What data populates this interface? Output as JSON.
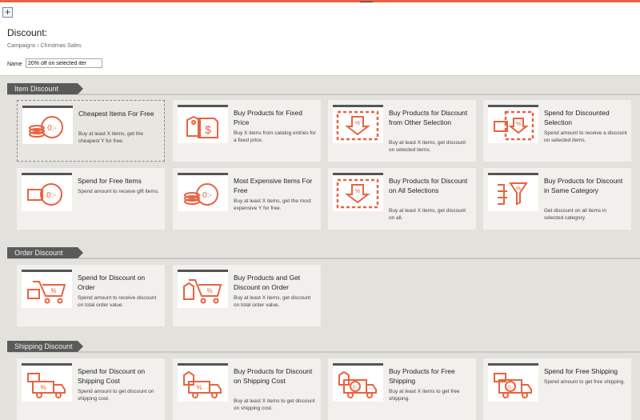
{
  "header": {
    "title": "Discount:",
    "breadcrumb": "Campaigns › Christmas Sales",
    "name_label": "Name",
    "name_value": "20% off on selected iter",
    "add_label": "+",
    "toggle_label": "▾"
  },
  "accent_color": "#e8633f",
  "sections": [
    {
      "label": "Item Discount",
      "cards": [
        {
          "title": "Cheapest Items For Free",
          "desc": "Buy at least X items, get the cheapest Y for free.",
          "icon": "coins-clock-icon",
          "selected": true
        },
        {
          "title": "Buy Products for Fixed Price",
          "desc": "Buy X items from catalog entries for a fixed price.",
          "icon": "price-tag-dollar-icon"
        },
        {
          "title": "Buy Products for Discount from Other Selection",
          "desc": "Buy at least X items, get discount on selected items.",
          "icon": "discount-selection-icon"
        },
        {
          "title": "Spend for Discounted Selection",
          "desc": "Spend amount to receive a discount on selected items.",
          "icon": "wallet-discount-icon"
        },
        {
          "title": "Spend for Free Items",
          "desc": "Spend amount to receive gift items.",
          "icon": "wallet-clock-icon"
        },
        {
          "title": "Most Expensive Items For Free",
          "desc": "Buy at least X items, get the most expensive Y for free.",
          "icon": "coins-clock-icon"
        },
        {
          "title": "Buy Products for Discount on All Selections",
          "desc": "Buy at least X items, get discount on all.",
          "icon": "discount-selection-icon"
        },
        {
          "title": "Buy Products for Discount in Same Category",
          "desc": "Get discount on all items in selected category.",
          "icon": "category-filter-icon"
        }
      ]
    },
    {
      "label": "Order Discount",
      "cards": [
        {
          "title": "Spend for Discount on Order",
          "desc": "Spend amount to receive discount on total order value.",
          "icon": "wallet-cart-icon"
        },
        {
          "title": "Buy Products and Get Discount on Order",
          "desc": "Buy at least X items, get discount on total order value.",
          "icon": "tag-cart-icon"
        }
      ]
    },
    {
      "label": "Shipping Discount",
      "cards": [
        {
          "title": "Spend for Discount on Shipping Cost",
          "desc": "Spend amount to get discount on shipping cost.",
          "icon": "wallet-truck-icon"
        },
        {
          "title": "Buy Products for Discount on Shipping Cost",
          "desc": "Buy at least X items to get discount on shipping cost.",
          "icon": "tag-truck-icon"
        },
        {
          "title": "Buy Products for Free Shipping",
          "desc": "Buy at least X items to get free shipping.",
          "icon": "tag-truck-clock-icon"
        },
        {
          "title": "Spend for Free Shipping",
          "desc": "Spend amount to get free shipping.",
          "icon": "wallet-truck-clock-icon"
        }
      ]
    }
  ]
}
